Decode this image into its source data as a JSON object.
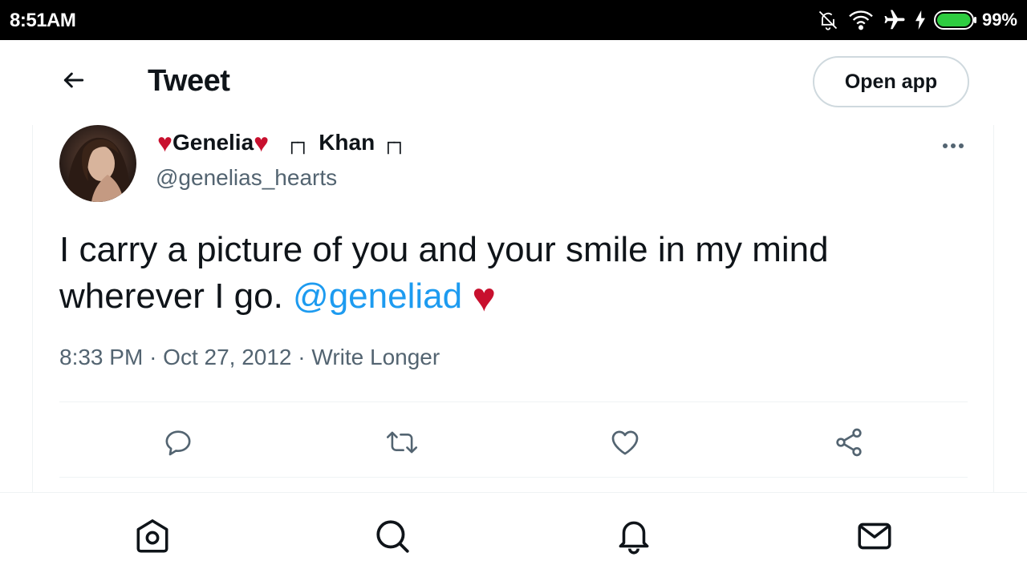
{
  "status_bar": {
    "time": "8:51AM",
    "battery_percent": "99%",
    "battery_level": 0.99,
    "icons": [
      "bell-muted-icon",
      "wifi-icon",
      "airplane-icon",
      "charging-bolt-icon",
      "battery-icon"
    ]
  },
  "header": {
    "title": "Tweet",
    "open_app_label": "Open app"
  },
  "tweet": {
    "display_name_part1": "Genelia",
    "display_name_part2": "Khan",
    "display_name_glyph_left": "┌┐",
    "display_name_glyph_right": "┌┐",
    "heart_glyph": "♥",
    "handle": "@genelias_hearts",
    "text_line": "I carry a picture of you and your smile in my mind wherever I go.",
    "mention": "@geneliad",
    "timestamp_time": "8:33 PM",
    "timestamp_date": "Oct 27, 2012",
    "source": "Write Longer",
    "separator": "·"
  },
  "actions": [
    "reply-icon",
    "retweet-icon",
    "like-icon",
    "share-icon"
  ],
  "tabs": [
    "home-icon",
    "search-icon",
    "notifications-icon",
    "messages-icon"
  ],
  "colors": {
    "text_primary": "#0f1419",
    "text_secondary": "#536471",
    "accent_blue": "#1d9bf0",
    "heart_red": "#c8102e",
    "border": "#eff3f4"
  }
}
